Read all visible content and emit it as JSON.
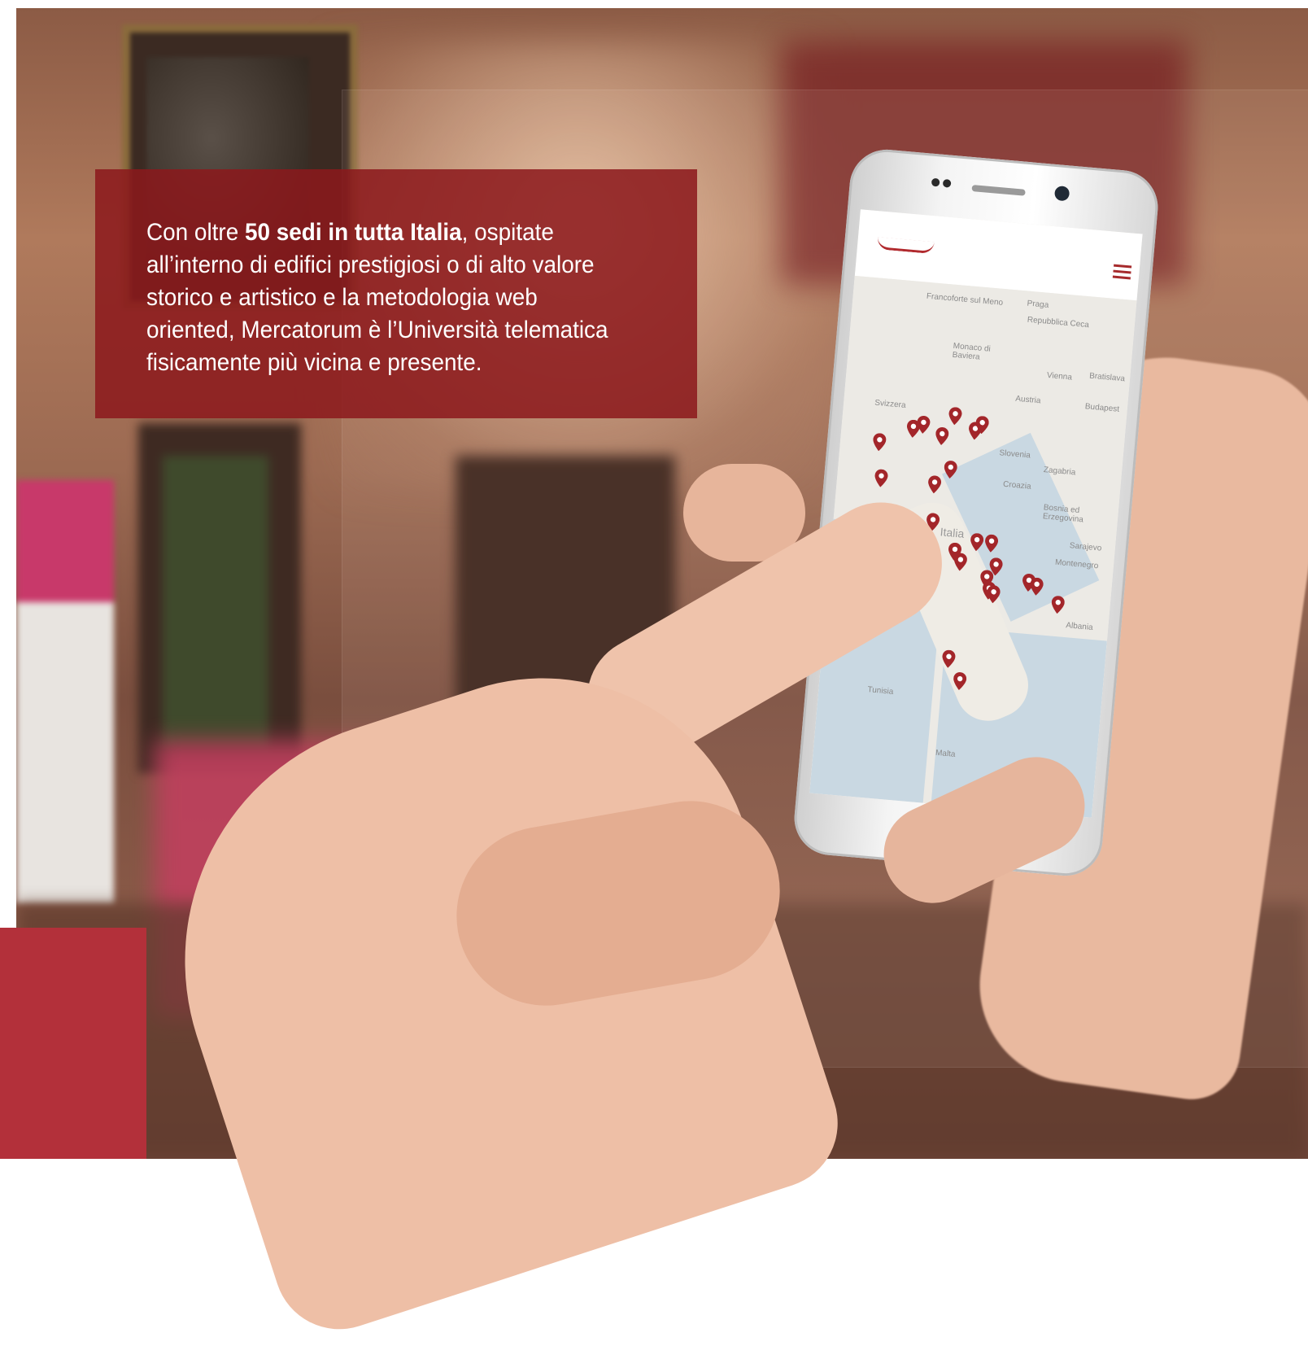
{
  "intro": {
    "part1": "Con oltre ",
    "highlight": "50 sedi in tutta Italia",
    "part2": ", ospitate all’interno di edifici prestigiosi o di alto valore storico e artistico e la metodologia web oriented, Mercatorum è l’Università telematica fisicamente più vicina e presente."
  },
  "colors": {
    "brand_red": "#8c181c",
    "accent_red": "#b3303a",
    "pin_red": "#a3262a"
  },
  "phone": {
    "icons": [
      "mercatorum-logo-icon",
      "hamburger-menu-icon",
      "map-pin-icon"
    ],
    "map_labels": {
      "frankfurt": "Francoforte sul Meno",
      "praga": "Praga",
      "repubblica_ceca": "Repubblica Ceca",
      "monaco": "Monaco di Baviera",
      "vienna": "Vienna",
      "bratislava": "Bratislava",
      "austria": "Austria",
      "budapest": "Budapest",
      "svizzera": "Svizzera",
      "slovenia": "Slovenia",
      "zagabria": "Zagabria",
      "croazia": "Croazia",
      "bosnia": "Bosnia ed Erzegovina",
      "sarajevo": "Sarajevo",
      "montenegro": "Montenegro",
      "italia": "Italia",
      "albania": "Albania",
      "tunisia": "Tunisia",
      "malta": "Malta"
    }
  }
}
